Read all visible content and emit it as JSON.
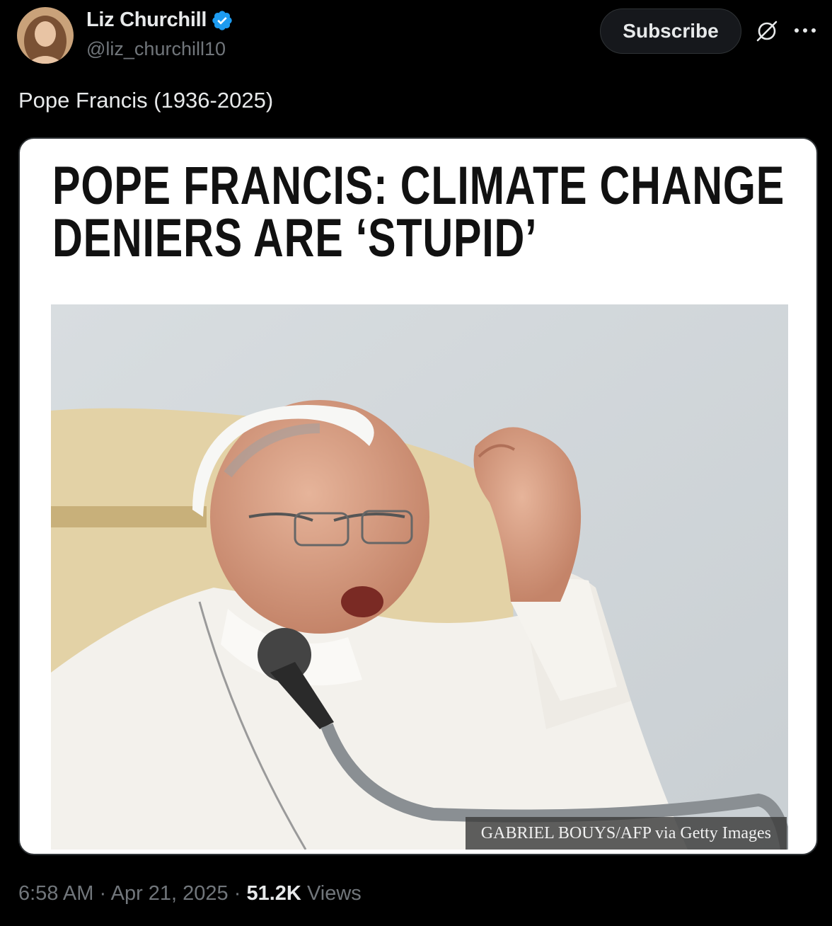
{
  "author": {
    "display_name": "Liz Churchill",
    "handle": "@liz_churchill10",
    "verified_icon": "verified-badge-icon",
    "verified_color": "#1d9bf0"
  },
  "actions": {
    "subscribe_label": "Subscribe",
    "grok_icon": "grok-icon",
    "more_icon": "more-icon"
  },
  "tweet": {
    "text": "Pope Francis (1936-2025)"
  },
  "media": {
    "headline_line1": "POPE FRANCIS: CLIMATE CHANGE",
    "headline_line2": "DENIERS ARE ‘STUPID’",
    "photo_credit": "GABRIEL BOUYS/AFP via Getty Images"
  },
  "meta": {
    "time": "6:58 AM",
    "sep1": "·",
    "date": "Apr 21, 2025",
    "sep2": "·",
    "views_count": "51.2K",
    "views_label": "Views"
  },
  "colors": {
    "background": "#000000",
    "text_primary": "#e7e9ea",
    "text_secondary": "#71767b",
    "accent": "#1d9bf0"
  }
}
